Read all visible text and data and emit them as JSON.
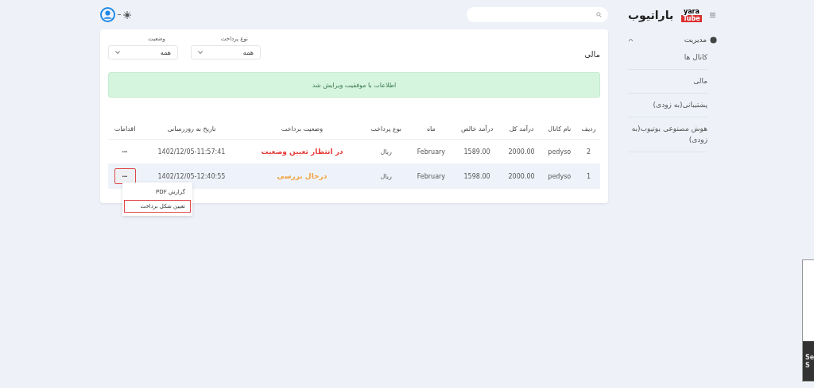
{
  "brand": {
    "badge_top": "yara",
    "badge_bottom": "Tube",
    "name": "باراتیوب"
  },
  "sidebar": {
    "section": {
      "label": "مدیریت",
      "expanded": true
    },
    "items": [
      {
        "label": "کانال ها"
      },
      {
        "label": "مالی"
      },
      {
        "label": "پشتیبانی(به زودی)"
      },
      {
        "label": "هوش مصنوعی یوتیوب(به زودی)"
      }
    ]
  },
  "page": {
    "title": "مالی",
    "filters": [
      {
        "label": "نوع پرداخت",
        "value": "همه"
      },
      {
        "label": "وضعیت",
        "value": "همه"
      }
    ],
    "alert": "اطلاعات با موفقیت ویرایش شد"
  },
  "table": {
    "columns": [
      "ردیف",
      "نام کانال",
      "درآمد کل",
      "درآمد خالص",
      "ماه",
      "نوع پرداخت",
      "وضعیت برداخت",
      "تاریخ به روزرسانی",
      "اقدامات"
    ],
    "rows": [
      {
        "selected": false,
        "cells": [
          "2",
          "pedyso",
          "2000.00",
          "1589.00",
          "February",
          "ریال"
        ],
        "status": {
          "label": "در انتظار تعیین وضعیت",
          "color": "#e53935"
        },
        "date": "1402/12/05-11:57:41",
        "action": {
          "label": "•••",
          "highlighted": false
        }
      },
      {
        "selected": true,
        "cells": [
          "1",
          "pedyso",
          "2000.00",
          "1598.00",
          "February",
          "ریال"
        ],
        "status": {
          "label": "درحال بررسی",
          "color": "#f2a444"
        },
        "date": "1402/12/05-12:40:55",
        "action": {
          "label": "•••",
          "highlighted": true
        }
      }
    ]
  },
  "action_menu": {
    "items": [
      {
        "label": "گزارش PDF",
        "highlighted": false
      },
      {
        "label": "تعیین شکل برداخت",
        "highlighted": true
      }
    ]
  },
  "side_popup": {
    "lines": [
      "Se",
      "S"
    ]
  }
}
